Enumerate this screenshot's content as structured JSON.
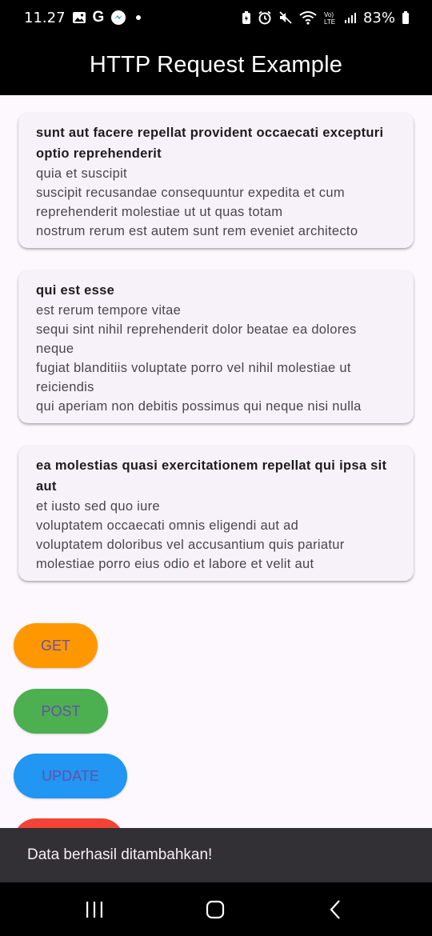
{
  "status_bar": {
    "time": "11.27",
    "g_letter": "G",
    "battery": "83%"
  },
  "app_bar": {
    "title": "HTTP Request Example"
  },
  "posts": [
    {
      "title": "sunt aut facere repellat provident occaecati excepturi optio reprehenderit",
      "body": "quia et suscipit\nsuscipit recusandae consequuntur expedita et cum reprehenderit molestiae ut ut quas totam\nnostrum rerum est autem sunt rem eveniet architecto"
    },
    {
      "title": "qui est esse",
      "body": "est rerum tempore vitae\nsequi sint nihil reprehenderit dolor beatae ea dolores neque\nfugiat blanditiis voluptate porro vel nihil molestiae ut reiciendis\nqui aperiam non debitis possimus qui neque nisi nulla"
    },
    {
      "title": "ea molestias quasi exercitationem repellat qui ipsa sit aut",
      "body": "et iusto sed quo iure\nvoluptatem occaecati omnis eligendi aut ad\nvoluptatem doloribus vel accusantium quis pariatur\nmolestiae porro eius odio et labore et velit aut"
    }
  ],
  "buttons": {
    "get": "GET",
    "post": "POST",
    "update": "UPDATE"
  },
  "snackbar": {
    "message": "Data berhasil ditambahkan!"
  },
  "icons": {
    "status_left": [
      "gallery-icon",
      "google-icon",
      "messenger-icon",
      "notification-dot-icon"
    ],
    "status_right": [
      "battery-saver-icon",
      "alarm-icon",
      "mute-icon",
      "wifi-icon",
      "volte-icon",
      "signal-icon",
      "battery-icon"
    ],
    "nav": [
      "recents-icon",
      "home-icon",
      "back-icon"
    ]
  },
  "colors": {
    "get_button": "#ff9800",
    "post_button": "#4caf50",
    "update_button": "#2196f3",
    "delete_button": "#f44336",
    "button_text": "#6750a4",
    "background": "#fdf7fe",
    "card": "#f7f2f9",
    "snackbar": "#322f35"
  }
}
